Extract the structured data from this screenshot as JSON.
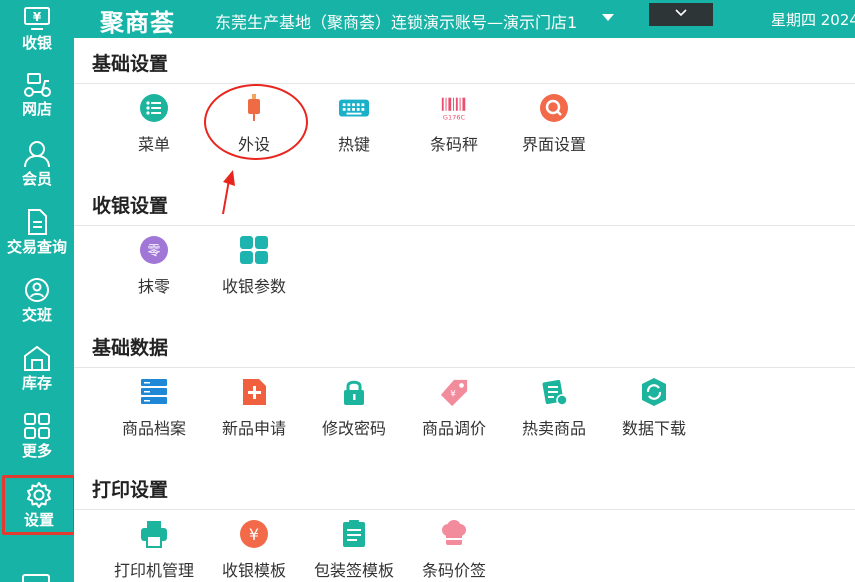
{
  "sidebar": {
    "items": [
      {
        "label": "收银",
        "icon": "cashier-icon"
      },
      {
        "label": "网店",
        "icon": "delivery-scooter-icon"
      },
      {
        "label": "会员",
        "icon": "member-icon"
      },
      {
        "label": "交易查询",
        "icon": "document-icon"
      },
      {
        "label": "交班",
        "icon": "shift-handover-icon"
      },
      {
        "label": "库存",
        "icon": "warehouse-icon"
      },
      {
        "label": "更多",
        "icon": "grid-icon"
      },
      {
        "label": "设置",
        "icon": "gear-icon",
        "active": true
      }
    ]
  },
  "header": {
    "logo": "聚商荟",
    "store": "东莞生产基地（聚商荟）连锁演示账号—演示门店1",
    "datetime": "星期四 2024"
  },
  "sections": [
    {
      "title": "基础设置",
      "items": [
        {
          "label": "菜单",
          "icon": "menu-list-icon"
        },
        {
          "label": "外设",
          "icon": "peripheral-plug-icon"
        },
        {
          "label": "热键",
          "icon": "keyboard-icon"
        },
        {
          "label": "条码秤",
          "icon": "barcode-scale-icon",
          "icon_text": "G176C"
        },
        {
          "label": "界面设置",
          "icon": "interface-search-icon"
        }
      ]
    },
    {
      "title": "收银设置",
      "items": [
        {
          "label": "抹零",
          "icon": "round-off-icon",
          "icon_text": "零"
        },
        {
          "label": "收银参数",
          "icon": "cashier-params-icon"
        }
      ]
    },
    {
      "title": "基础数据",
      "items": [
        {
          "label": "商品档案",
          "icon": "product-archive-icon"
        },
        {
          "label": "新品申请",
          "icon": "new-product-icon"
        },
        {
          "label": "修改密码",
          "icon": "lock-icon"
        },
        {
          "label": "商品调价",
          "icon": "price-tag-icon"
        },
        {
          "label": "热卖商品",
          "icon": "hot-product-icon"
        },
        {
          "label": "数据下载",
          "icon": "data-download-icon"
        }
      ]
    },
    {
      "title": "打印设置",
      "items": [
        {
          "label": "打印机管理",
          "icon": "printer-icon"
        },
        {
          "label": "收银模板",
          "icon": "yuan-template-icon",
          "icon_text": "¥"
        },
        {
          "label": "包装签模板",
          "icon": "package-label-icon"
        },
        {
          "label": "条码价签",
          "icon": "barcode-price-tag-icon"
        }
      ]
    }
  ],
  "colors": {
    "primary": "#17b3a6",
    "annotation": "#e8261f"
  }
}
